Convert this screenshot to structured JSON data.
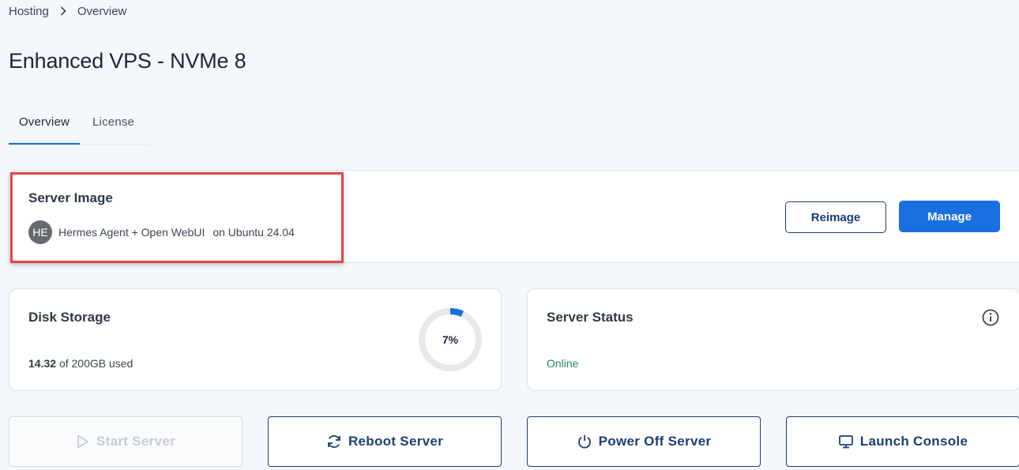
{
  "breadcrumb": {
    "root": "Hosting",
    "current": "Overview"
  },
  "page": {
    "title": "Enhanced VPS - NVMe 8"
  },
  "tabs": [
    {
      "label": "Overview"
    },
    {
      "label": "License"
    }
  ],
  "server_image": {
    "title": "Server Image",
    "avatar_initials": "HE",
    "name": "Hermes Agent + Open WebUI",
    "os": "on Ubuntu 24.04",
    "reimage_label": "Reimage",
    "manage_label": "Manage"
  },
  "disk": {
    "title": "Disk Storage",
    "used": "14.32",
    "of_text": "of 200GB used",
    "percent_label": "7%",
    "percent": 7
  },
  "status": {
    "title": "Server Status",
    "value": "Online"
  },
  "actions": {
    "start": "Start Server",
    "reboot": "Reboot Server",
    "power_off": "Power Off Server",
    "console": "Launch Console"
  },
  "colors": {
    "accent": "#1a6fe0",
    "highlight": "#e2474c",
    "online": "#1f8a5c",
    "navy": "#1b3f73"
  }
}
